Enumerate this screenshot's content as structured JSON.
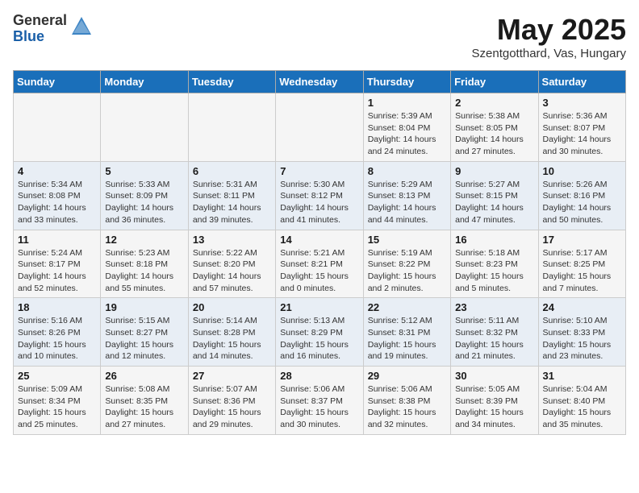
{
  "header": {
    "logo_general": "General",
    "logo_blue": "Blue",
    "month": "May 2025",
    "location": "Szentgotthard, Vas, Hungary"
  },
  "days_of_week": [
    "Sunday",
    "Monday",
    "Tuesday",
    "Wednesday",
    "Thursday",
    "Friday",
    "Saturday"
  ],
  "weeks": [
    [
      {
        "day": "",
        "info": ""
      },
      {
        "day": "",
        "info": ""
      },
      {
        "day": "",
        "info": ""
      },
      {
        "day": "",
        "info": ""
      },
      {
        "day": "1",
        "info": "Sunrise: 5:39 AM\nSunset: 8:04 PM\nDaylight: 14 hours\nand 24 minutes."
      },
      {
        "day": "2",
        "info": "Sunrise: 5:38 AM\nSunset: 8:05 PM\nDaylight: 14 hours\nand 27 minutes."
      },
      {
        "day": "3",
        "info": "Sunrise: 5:36 AM\nSunset: 8:07 PM\nDaylight: 14 hours\nand 30 minutes."
      }
    ],
    [
      {
        "day": "4",
        "info": "Sunrise: 5:34 AM\nSunset: 8:08 PM\nDaylight: 14 hours\nand 33 minutes."
      },
      {
        "day": "5",
        "info": "Sunrise: 5:33 AM\nSunset: 8:09 PM\nDaylight: 14 hours\nand 36 minutes."
      },
      {
        "day": "6",
        "info": "Sunrise: 5:31 AM\nSunset: 8:11 PM\nDaylight: 14 hours\nand 39 minutes."
      },
      {
        "day": "7",
        "info": "Sunrise: 5:30 AM\nSunset: 8:12 PM\nDaylight: 14 hours\nand 41 minutes."
      },
      {
        "day": "8",
        "info": "Sunrise: 5:29 AM\nSunset: 8:13 PM\nDaylight: 14 hours\nand 44 minutes."
      },
      {
        "day": "9",
        "info": "Sunrise: 5:27 AM\nSunset: 8:15 PM\nDaylight: 14 hours\nand 47 minutes."
      },
      {
        "day": "10",
        "info": "Sunrise: 5:26 AM\nSunset: 8:16 PM\nDaylight: 14 hours\nand 50 minutes."
      }
    ],
    [
      {
        "day": "11",
        "info": "Sunrise: 5:24 AM\nSunset: 8:17 PM\nDaylight: 14 hours\nand 52 minutes."
      },
      {
        "day": "12",
        "info": "Sunrise: 5:23 AM\nSunset: 8:18 PM\nDaylight: 14 hours\nand 55 minutes."
      },
      {
        "day": "13",
        "info": "Sunrise: 5:22 AM\nSunset: 8:20 PM\nDaylight: 14 hours\nand 57 minutes."
      },
      {
        "day": "14",
        "info": "Sunrise: 5:21 AM\nSunset: 8:21 PM\nDaylight: 15 hours\nand 0 minutes."
      },
      {
        "day": "15",
        "info": "Sunrise: 5:19 AM\nSunset: 8:22 PM\nDaylight: 15 hours\nand 2 minutes."
      },
      {
        "day": "16",
        "info": "Sunrise: 5:18 AM\nSunset: 8:23 PM\nDaylight: 15 hours\nand 5 minutes."
      },
      {
        "day": "17",
        "info": "Sunrise: 5:17 AM\nSunset: 8:25 PM\nDaylight: 15 hours\nand 7 minutes."
      }
    ],
    [
      {
        "day": "18",
        "info": "Sunrise: 5:16 AM\nSunset: 8:26 PM\nDaylight: 15 hours\nand 10 minutes."
      },
      {
        "day": "19",
        "info": "Sunrise: 5:15 AM\nSunset: 8:27 PM\nDaylight: 15 hours\nand 12 minutes."
      },
      {
        "day": "20",
        "info": "Sunrise: 5:14 AM\nSunset: 8:28 PM\nDaylight: 15 hours\nand 14 minutes."
      },
      {
        "day": "21",
        "info": "Sunrise: 5:13 AM\nSunset: 8:29 PM\nDaylight: 15 hours\nand 16 minutes."
      },
      {
        "day": "22",
        "info": "Sunrise: 5:12 AM\nSunset: 8:31 PM\nDaylight: 15 hours\nand 19 minutes."
      },
      {
        "day": "23",
        "info": "Sunrise: 5:11 AM\nSunset: 8:32 PM\nDaylight: 15 hours\nand 21 minutes."
      },
      {
        "day": "24",
        "info": "Sunrise: 5:10 AM\nSunset: 8:33 PM\nDaylight: 15 hours\nand 23 minutes."
      }
    ],
    [
      {
        "day": "25",
        "info": "Sunrise: 5:09 AM\nSunset: 8:34 PM\nDaylight: 15 hours\nand 25 minutes."
      },
      {
        "day": "26",
        "info": "Sunrise: 5:08 AM\nSunset: 8:35 PM\nDaylight: 15 hours\nand 27 minutes."
      },
      {
        "day": "27",
        "info": "Sunrise: 5:07 AM\nSunset: 8:36 PM\nDaylight: 15 hours\nand 29 minutes."
      },
      {
        "day": "28",
        "info": "Sunrise: 5:06 AM\nSunset: 8:37 PM\nDaylight: 15 hours\nand 30 minutes."
      },
      {
        "day": "29",
        "info": "Sunrise: 5:06 AM\nSunset: 8:38 PM\nDaylight: 15 hours\nand 32 minutes."
      },
      {
        "day": "30",
        "info": "Sunrise: 5:05 AM\nSunset: 8:39 PM\nDaylight: 15 hours\nand 34 minutes."
      },
      {
        "day": "31",
        "info": "Sunrise: 5:04 AM\nSunset: 8:40 PM\nDaylight: 15 hours\nand 35 minutes."
      }
    ]
  ]
}
